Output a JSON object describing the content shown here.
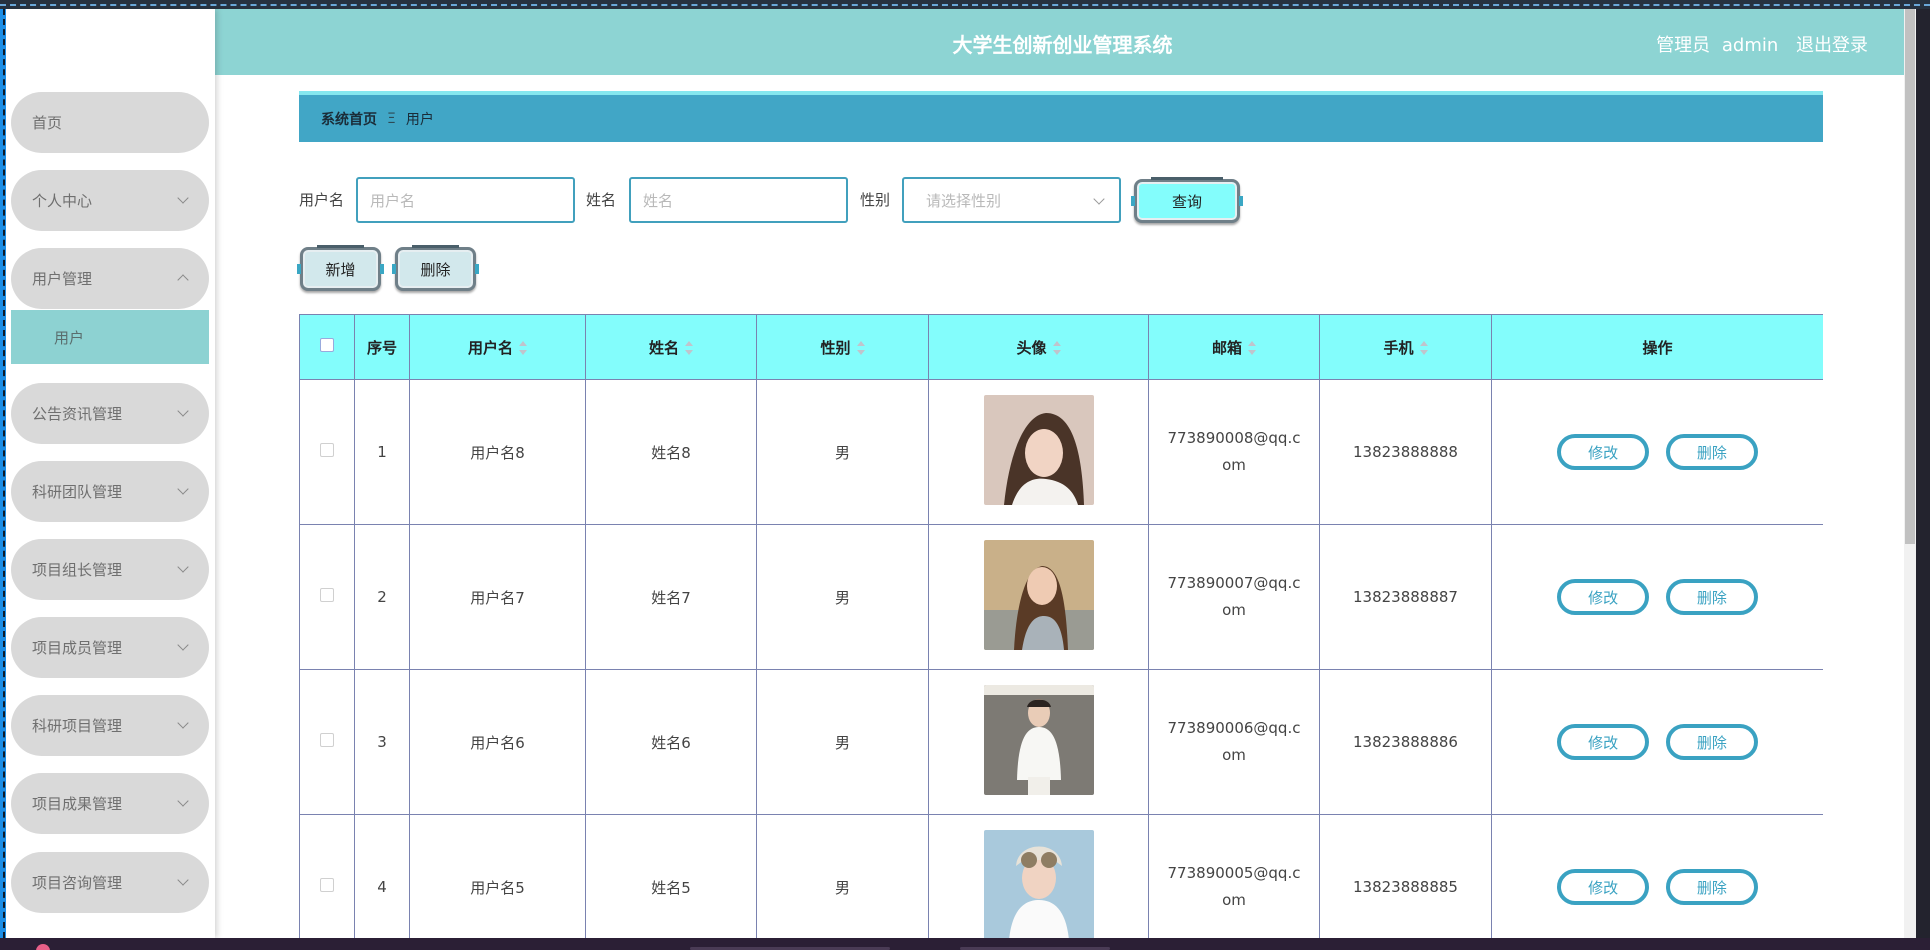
{
  "header": {
    "title": "大学生创新创业管理系统",
    "role": "管理员",
    "username": "admin",
    "logout": "退出登录"
  },
  "sidebar": {
    "items": [
      {
        "label": "首页",
        "icon": "none"
      },
      {
        "label": "个人中心",
        "icon": "chevron-down-icon"
      },
      {
        "label": "用户管理",
        "icon": "chevron-up-icon"
      },
      {
        "label": "公告资讯管理",
        "icon": "chevron-down-icon"
      },
      {
        "label": "科研团队管理",
        "icon": "chevron-down-icon"
      },
      {
        "label": "项目组长管理",
        "icon": "chevron-down-icon"
      },
      {
        "label": "项目成员管理",
        "icon": "chevron-down-icon"
      },
      {
        "label": "科研项目管理",
        "icon": "chevron-down-icon"
      },
      {
        "label": "项目成果管理",
        "icon": "chevron-down-icon"
      },
      {
        "label": "项目咨询管理",
        "icon": "chevron-down-icon"
      }
    ],
    "submenu": {
      "label": "用户"
    }
  },
  "breadcrumb": {
    "home": "系统首页",
    "separator": "Ξ",
    "current": "用户"
  },
  "search": {
    "username_label": "用户名",
    "username_placeholder": "用户名",
    "name_label": "姓名",
    "name_placeholder": "姓名",
    "gender_label": "性别",
    "gender_placeholder": "请选择性别",
    "query_button": "查询"
  },
  "actions": {
    "add_button": "新增",
    "delete_button": "删除"
  },
  "table": {
    "headers": [
      "序号",
      "用户名",
      "姓名",
      "性别",
      "头像",
      "邮箱",
      "手机",
      "操作"
    ],
    "rows": [
      {
        "index": "1",
        "username": "用户名8",
        "name": "姓名8",
        "gender": "男",
        "email": "773890008@qq.com",
        "phone": "13823888888"
      },
      {
        "index": "2",
        "username": "用户名7",
        "name": "姓名7",
        "gender": "男",
        "email": "773890007@qq.com",
        "phone": "13823888887"
      },
      {
        "index": "3",
        "username": "用户名6",
        "name": "姓名6",
        "gender": "男",
        "email": "773890006@qq.com",
        "phone": "13823888886"
      },
      {
        "index": "4",
        "username": "用户名5",
        "name": "姓名5",
        "gender": "男",
        "email": "773890005@qq.com",
        "phone": "13823888885"
      }
    ],
    "edit_label": "修改",
    "delete_label": "删除"
  },
  "colors": {
    "header_bg": "#8dd4d3",
    "breadcrumb_bg": "#41a6c6",
    "table_header_bg": "#83fdfc",
    "accent": "#3aa2c2",
    "submenu_bg": "#8dd2d2"
  }
}
